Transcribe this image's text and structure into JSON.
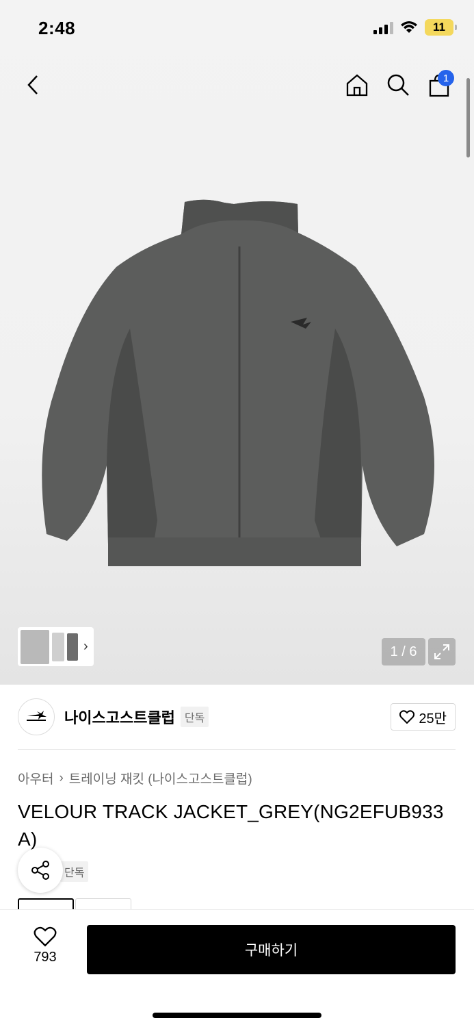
{
  "status_bar": {
    "time": "2:48",
    "battery": "11"
  },
  "nav": {
    "cart_count": "1"
  },
  "gallery": {
    "counter": "1 / 6"
  },
  "brand": {
    "name": "나이스고스트클럽",
    "tag": "단독",
    "likes": "25만"
  },
  "breadcrumb": {
    "category": "아우터",
    "sub": "트레이닝 재킷 (나이스고스트클럽)"
  },
  "product": {
    "title": "VELOUR TRACK JACKET_GREY(NG2EFUB933A)",
    "badge": "단독"
  },
  "bottom": {
    "wish_count": "793",
    "buy_label": "구매하기"
  },
  "colors": {
    "accent": "#2563eb",
    "buy_bg": "#000000",
    "jacket": "#5c5d5c"
  }
}
